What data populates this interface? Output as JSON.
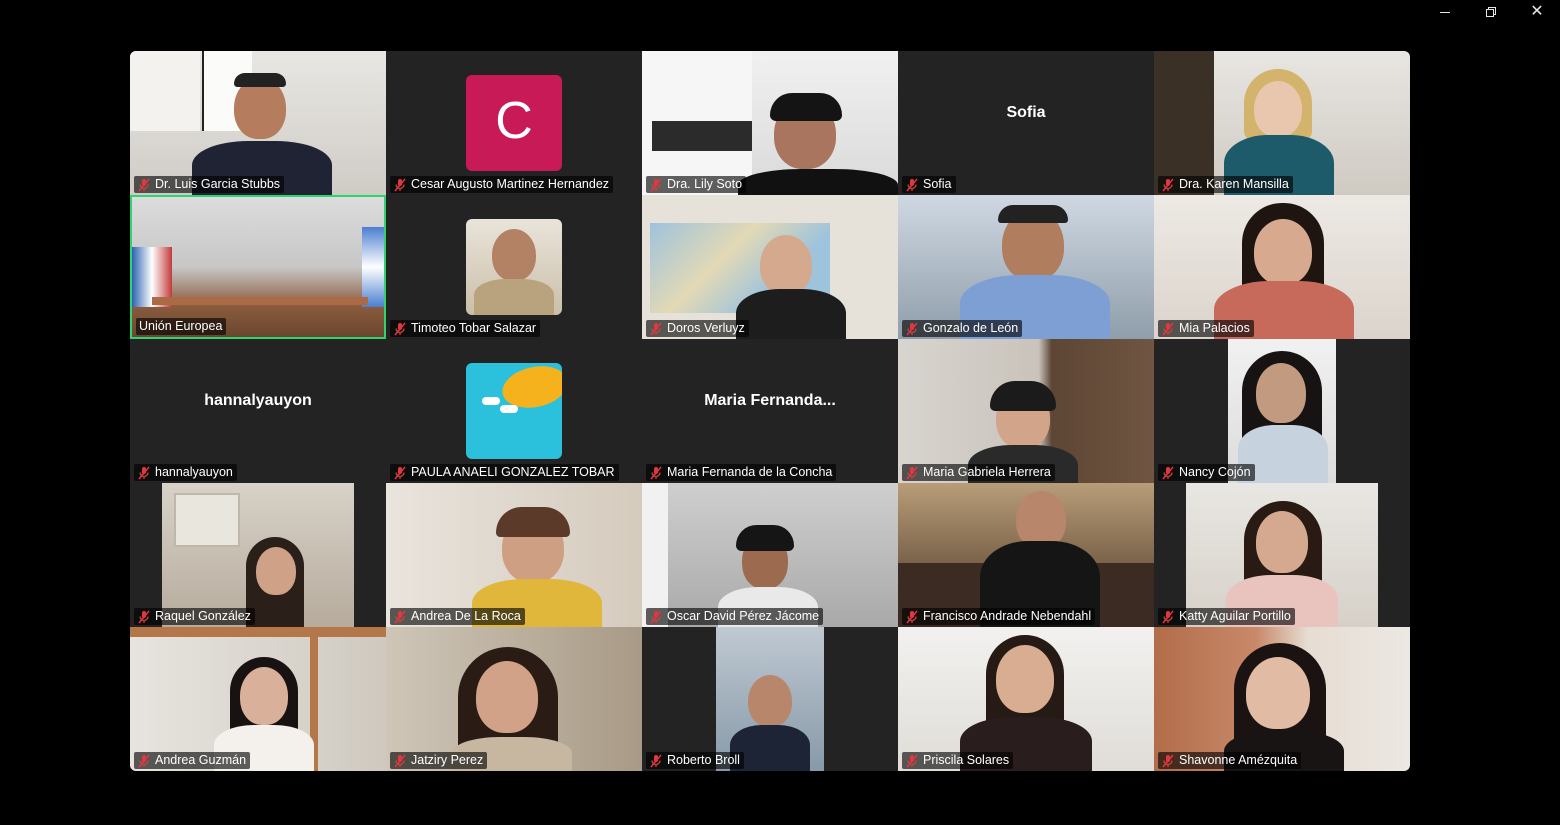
{
  "window": {
    "controls": [
      "minimize-icon",
      "restore-icon",
      "close-icon"
    ]
  },
  "colors": {
    "active_speaker_border": "#2fd36f",
    "avatar_c_bg": "#c81a57",
    "muted_mic": "#e0383e"
  },
  "participants": [
    {
      "name": "Dr. Luis Garcia Stubbs",
      "muted": true
    },
    {
      "name": "Cesar Augusto Martinez Hernandez",
      "muted": true,
      "avatar_letter": "C"
    },
    {
      "name": "Dra. Lily Soto",
      "muted": true
    },
    {
      "name": "Sofia",
      "muted": true,
      "display_name": "Sofia"
    },
    {
      "name": "Dra. Karen Mansilla",
      "muted": true
    },
    {
      "name": "Unión Europea",
      "muted": false,
      "active_speaker": true
    },
    {
      "name": "Timoteo Tobar Salazar",
      "muted": true
    },
    {
      "name": "Doros Verluyz",
      "muted": true
    },
    {
      "name": "Gonzalo de León",
      "muted": true
    },
    {
      "name": "Mia Palacios",
      "muted": true
    },
    {
      "name": "hannalyauyon",
      "muted": true,
      "display_name": "hannalyauyon"
    },
    {
      "name": "PAULA ANAELI GONZALEZ TOBAR",
      "muted": true
    },
    {
      "name": "Maria Fernanda de la Concha",
      "muted": true,
      "display_name": "Maria  Fernanda..."
    },
    {
      "name": "Maria Gabriela Herrera",
      "muted": true
    },
    {
      "name": "Nancy Cojón",
      "muted": true
    },
    {
      "name": "Raquel González",
      "muted": true
    },
    {
      "name": "Andrea De La Roca",
      "muted": true
    },
    {
      "name": "Oscar David Pérez Jácome",
      "muted": true
    },
    {
      "name": "Francisco Andrade Nebendahl",
      "muted": true
    },
    {
      "name": "Katty Aguilar Portillo",
      "muted": true
    },
    {
      "name": "Andrea Guzmán",
      "muted": true
    },
    {
      "name": "Jatziry Perez",
      "muted": true
    },
    {
      "name": "Roberto Broll",
      "muted": true
    },
    {
      "name": "Priscila Solares",
      "muted": true
    },
    {
      "name": "Shavonne Amézquita",
      "muted": true
    }
  ]
}
